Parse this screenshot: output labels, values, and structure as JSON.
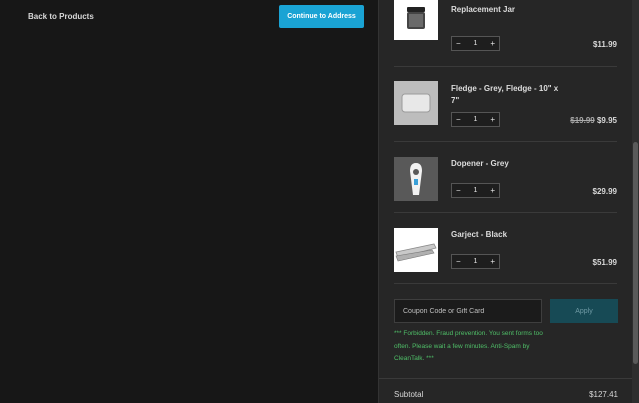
{
  "header": {
    "back_label": "Back to Products",
    "continue_label": "Continue to Address"
  },
  "cart": {
    "items": [
      {
        "name": "Ortwo - Beechwood Ortwo Replacement Jar",
        "qty": "1",
        "price": "$11.99",
        "old_price": ""
      },
      {
        "name": "Fledge - Grey, Fledge - 10\" x 7\"",
        "qty": "1",
        "price": "$9.95",
        "old_price": "$19.99"
      },
      {
        "name": "Dopener - Grey",
        "qty": "1",
        "price": "$29.99",
        "old_price": ""
      },
      {
        "name": "Garject - Black",
        "qty": "1",
        "price": "$51.99",
        "old_price": ""
      }
    ],
    "minus_symbol": "−",
    "plus_symbol": "+",
    "coupon_placeholder": "Coupon Code or Gift Card",
    "apply_label": "Apply",
    "error_message": "*** Forbidden. Fraud prevention. You sent forms too often. Please wait a few minutes. Anti-Spam by CleanTalk. ***",
    "subtotal_label": "Subtotal",
    "subtotal_value": "$127.41"
  },
  "colors": {
    "accent": "#1aa3d4",
    "error": "#4fbf68"
  }
}
